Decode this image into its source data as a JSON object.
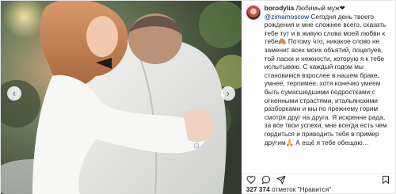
{
  "post": {
    "username": "borodylia",
    "caption_lead": "Любимый муж❤",
    "mention": "@zimamoscow",
    "caption_body": "Сегодня день твоего рождения и мне сложнее всего, сказать тебе тут и в живую слова моей любви к тебе🙈 Потому что, никакое слово не заменит всех моих объятий, поцелуев, той ласки и нежности, которую я к тебе испытываю. С каждый годом мы становимся взрослее в нашем браке, умнее, терпимее, хотя конечно умеем быть сумасшедшими подростками с огненными страстями, итальянскими разборками и мы по прежнему горим смотря друг на друга. Я искренне рада, за все твои успехи, мне всегда есть чем гордиться и приводить тебя в пример другим🙏 А ещё я тебе обещаю…",
    "likes_count": "327 374",
    "likes_label": "отметок \"Нравится\""
  },
  "icons": {
    "prev": "chevron-left-icon",
    "next": "chevron-right-icon",
    "like": "heart-icon",
    "comment": "comment-icon",
    "share": "share-icon",
    "save": "bookmark-icon"
  },
  "colors": {
    "story_ring": "#d62976",
    "mention": "#003569",
    "text": "#262626"
  }
}
